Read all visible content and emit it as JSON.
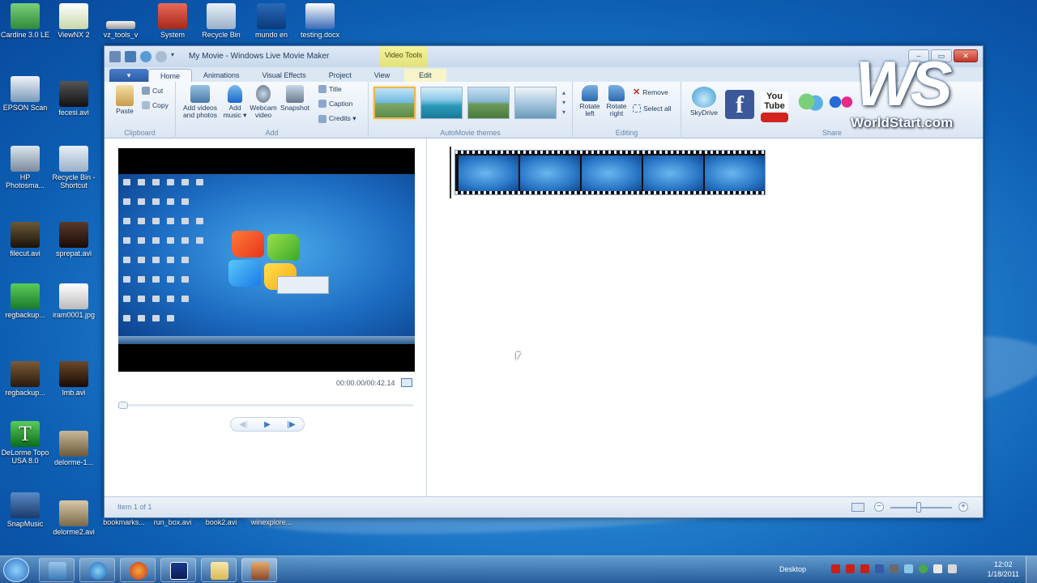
{
  "desktop": {
    "icons": [
      {
        "label": "Cardine 3.0 LE"
      },
      {
        "label": "ViewNX 2"
      },
      {
        "label": "vz_tools_v"
      },
      {
        "label": "System"
      },
      {
        "label": "Recycle Bin"
      },
      {
        "label": "mundo en"
      },
      {
        "label": "testing.docx"
      },
      {
        "label": "EPSON Scan"
      },
      {
        "label": "fecesi.avi"
      },
      {
        "label": "HP Photosma..."
      },
      {
        "label": "Recycle Bin - Shortcut"
      },
      {
        "label": "filecut.avi"
      },
      {
        "label": "sprepat.avi"
      },
      {
        "label": "regbackup..."
      },
      {
        "label": "iram0001.jpg"
      },
      {
        "label": "regbackup..."
      },
      {
        "label": "lmb.avi"
      },
      {
        "label": "DeLorme Topo USA 8.0"
      },
      {
        "label": "delorme-1..."
      },
      {
        "label": "SnapMusic"
      },
      {
        "label": "delorme2.avi"
      },
      {
        "label": "bookmarks..."
      },
      {
        "label": "run_box.avi"
      },
      {
        "label": "book2.avi"
      },
      {
        "label": "winexplore..."
      }
    ]
  },
  "window": {
    "title": "My Movie - Windows Live Movie Maker",
    "contextual_tab_group": "Video Tools",
    "buttons": {
      "minimize": "–",
      "maximize": "▭",
      "close": "✕"
    }
  },
  "ribbon": {
    "app_menu": "▾",
    "tabs": [
      "Home",
      "Animations",
      "Visual Effects",
      "Project",
      "View",
      "Edit"
    ],
    "groups": {
      "clipboard": {
        "label": "Clipboard",
        "paste": "Paste",
        "cut": "Cut",
        "copy": "Copy"
      },
      "add": {
        "label": "Add",
        "add_videos": "Add videos and photos",
        "add_music": "Add music ▾",
        "webcam": "Webcam video",
        "snapshot": "Snapshot",
        "title": "Title",
        "caption": "Caption",
        "credits": "Credits ▾"
      },
      "themes": {
        "label": "AutoMovie themes"
      },
      "editing": {
        "label": "Editing",
        "rotate_left": "Rotate left",
        "rotate_right": "Rotate right",
        "remove": "Remove",
        "select_all": "Select all"
      },
      "share": {
        "label": "Share",
        "skydrive": "SkyDrive",
        "facebook": "f",
        "youtube": "You Tube"
      }
    }
  },
  "preview": {
    "time": "00:00.00/00:42.14",
    "prev_frame": "◀|",
    "play": "▶",
    "next_frame": "|▶",
    "progress": 0
  },
  "status": {
    "text": "Item 1 of 1",
    "zoom_out": "−",
    "zoom_in": "+",
    "zoom_level": 0.45
  },
  "watermark": {
    "letters": "WS",
    "url": "WorldStart.com"
  },
  "taskbar": {
    "tray_label": "Desktop",
    "time": "12:02",
    "date": "1/18/2011"
  },
  "colors": {
    "desktop": "#1c6cc2",
    "ribbon_accent": "#2a5aa6",
    "contextual_tab": "#f6f39a",
    "close_button": "#c4362a",
    "youtube_red": "#d2231e",
    "facebook_blue": "#3b5998"
  }
}
